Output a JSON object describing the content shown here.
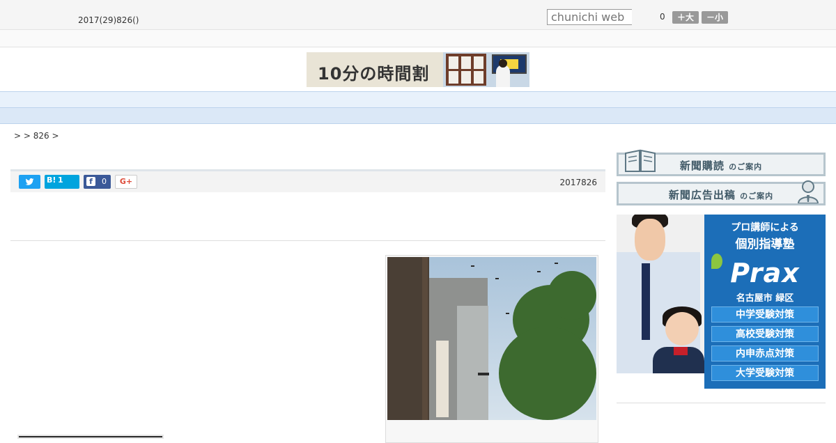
{
  "header": {
    "date": "2017(29)826()",
    "search_placeholder": "chunichi web",
    "font_size_value": "0",
    "font_larger_label": "＋大",
    "font_smaller_label": "－小"
  },
  "banner": {
    "text": "10分の時間割"
  },
  "nav": {
    "items": [
      "　",
      "　",
      "　",
      "　",
      "　",
      "　",
      "　",
      "　",
      "　"
    ]
  },
  "breadcrumb": {
    "text": ">  > 826 >"
  },
  "share": {
    "hatena_label": "B!",
    "hatena_count": "1",
    "facebook_count": "0",
    "google_label": "G+",
    "date": "2017826"
  },
  "sidebar": {
    "subscribe_main": "新聞購読",
    "subscribe_suffix": "のご案内",
    "ad_main": "新聞広告出稿",
    "ad_suffix": "のご案内"
  },
  "prax_ad": {
    "tagline": "プロ講師による",
    "headline": "個別指導塾",
    "logo": "Prax",
    "area": "名古屋市 緑区",
    "ctas": [
      "中学受験対策",
      "高校受験対策",
      "内申赤点対策",
      "大学受験対策"
    ],
    "colors": {
      "panel": "#1c6eb8",
      "button": "#2f8fdb"
    }
  }
}
